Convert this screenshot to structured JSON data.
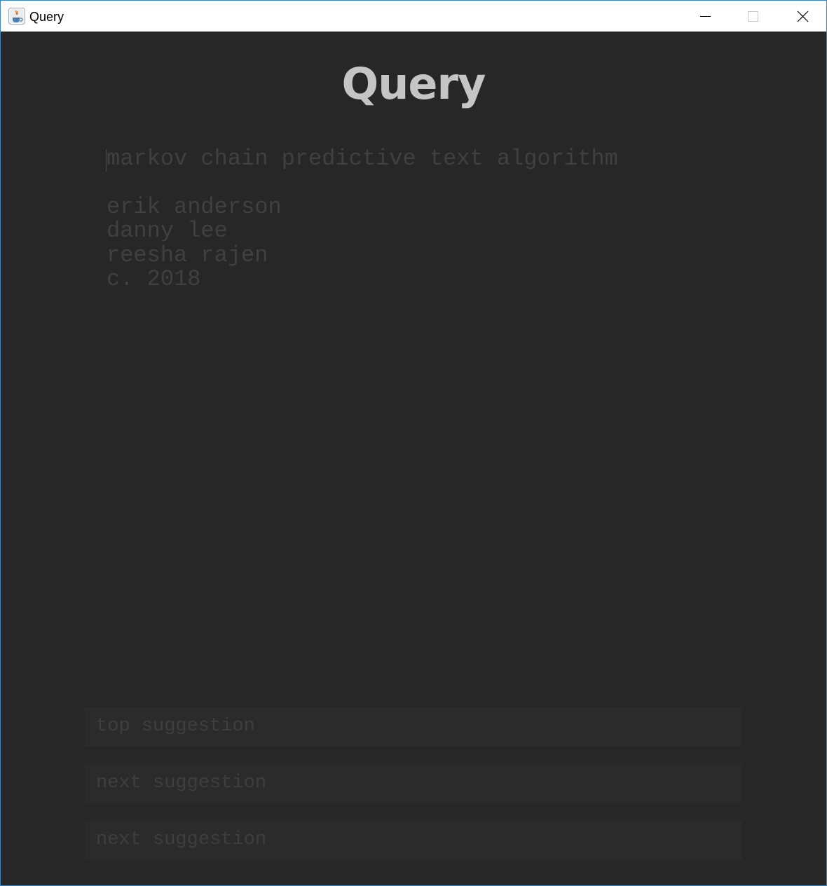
{
  "window": {
    "title": "Query",
    "icons": {
      "app": "java-cup-icon",
      "minimize": "minimize-icon",
      "maximize": "maximize-icon",
      "close": "close-icon"
    }
  },
  "app": {
    "heading": "Query",
    "input_text": "markov chain predictive text algorithm",
    "credits": [
      "erik anderson",
      "danny lee",
      "reesha rajen",
      "c. 2018"
    ]
  },
  "suggestions": [
    "top suggestion",
    "next suggestion",
    "next suggestion"
  ],
  "colors": {
    "background": "#282728",
    "heading": "#c5c5c5",
    "text": "#414041",
    "suggestion_bg": "#2c2b2c"
  }
}
